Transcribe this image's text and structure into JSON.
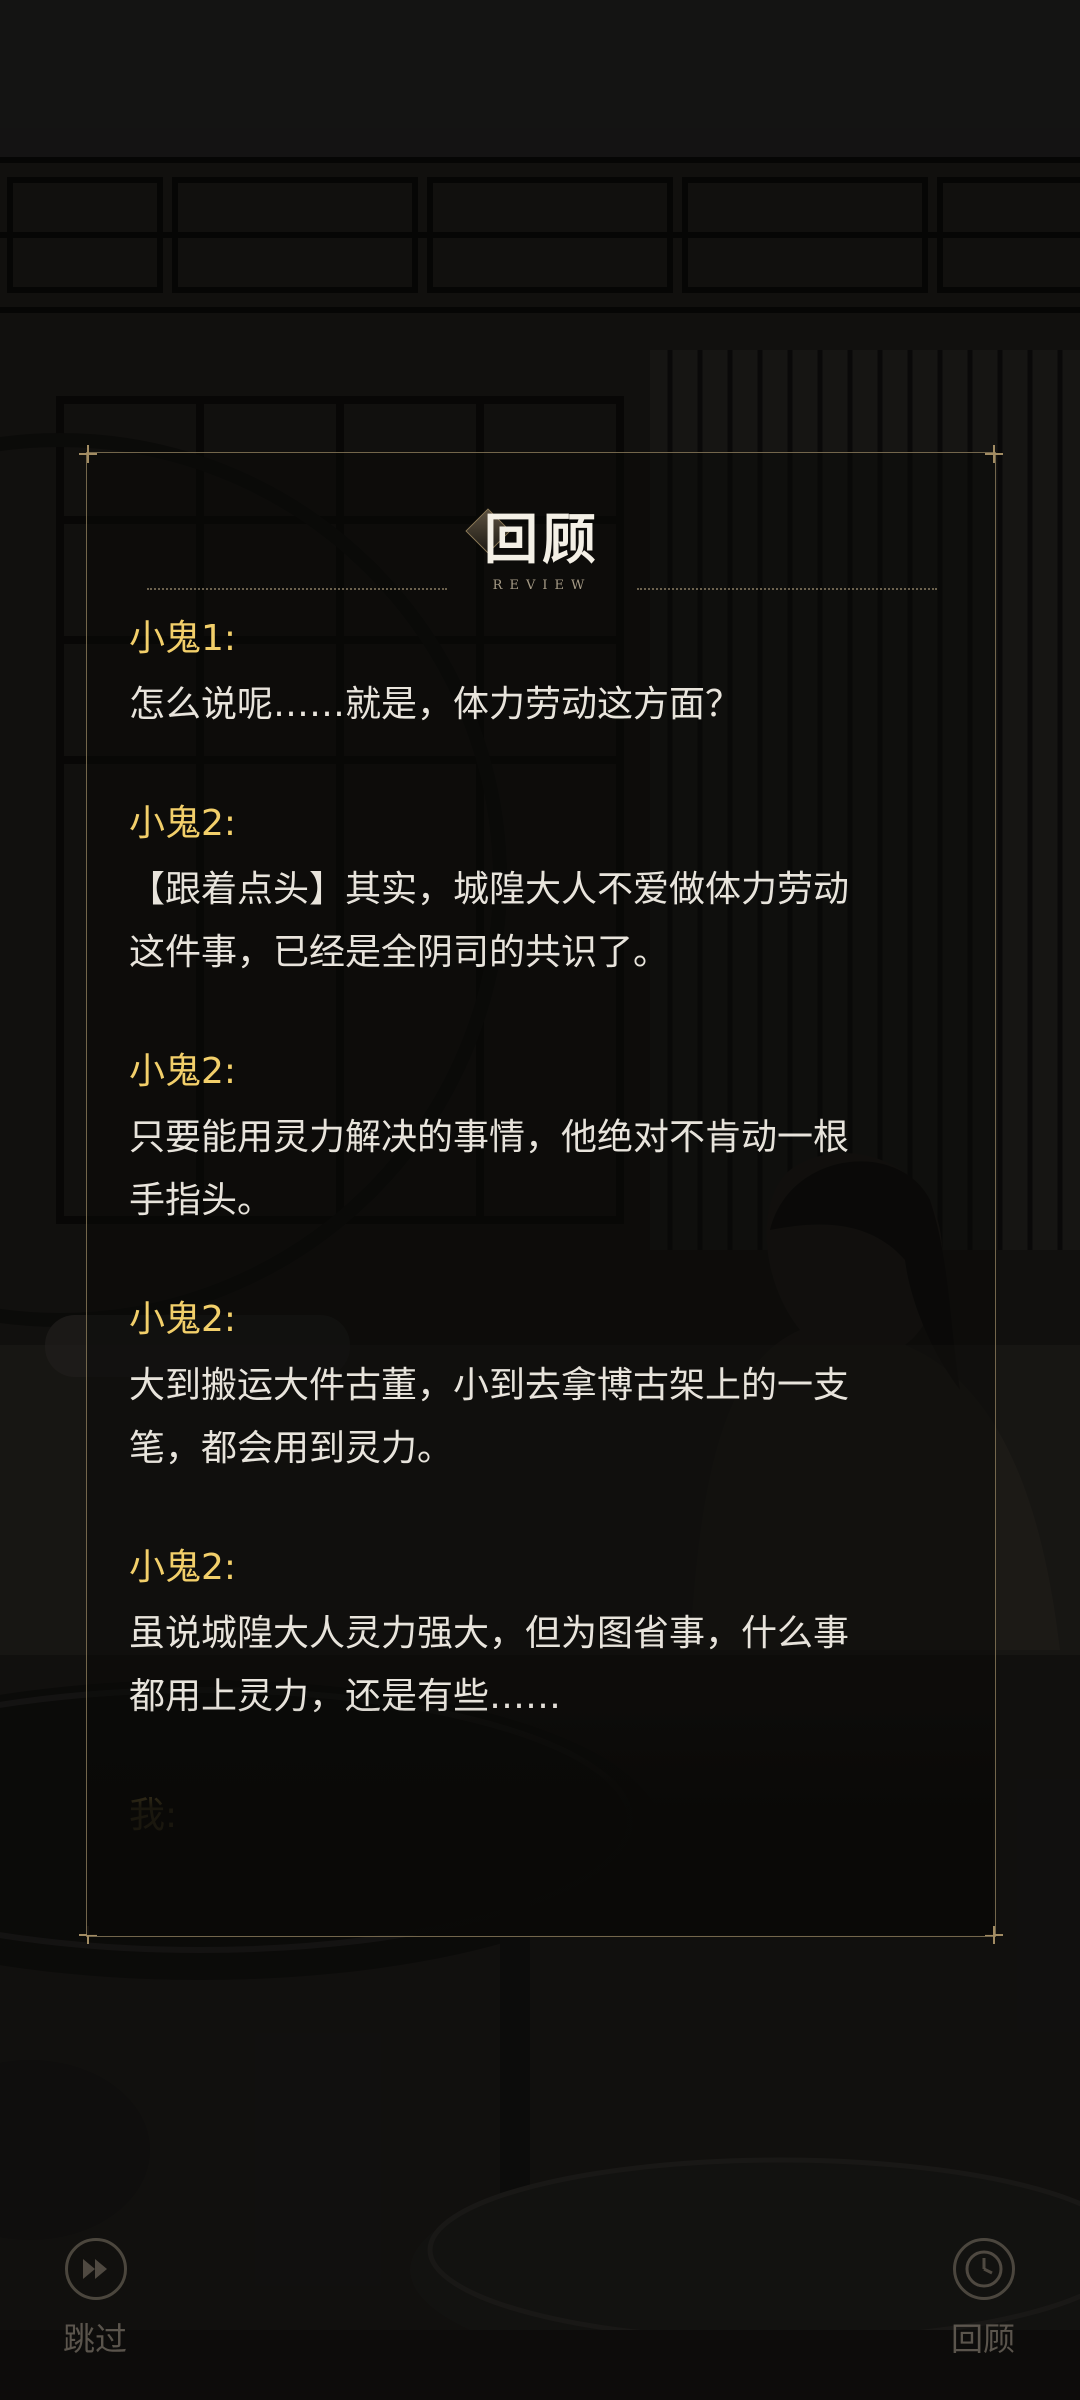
{
  "review": {
    "title": "回顾",
    "subtitle": "REVIEW"
  },
  "log": [
    {
      "speaker": "小鬼1:",
      "lines": [
        "怎么说呢……就是，体力劳动这方面？"
      ]
    },
    {
      "speaker": "小鬼2:",
      "lines": [
        "【跟着点头】其实，城隍大人不爱做体力劳动",
        "这件事，已经是全阴司的共识了。"
      ]
    },
    {
      "speaker": "小鬼2:",
      "lines": [
        "只要能用灵力解决的事情，他绝对不肯动一根",
        "手指头。"
      ]
    },
    {
      "speaker": "小鬼2:",
      "lines": [
        "大到搬运大件古董，小到去拿博古架上的一支",
        "笔，都会用到灵力。"
      ]
    },
    {
      "speaker": "小鬼2:",
      "lines": [
        "虽说城隍大人灵力强大，但为图省事，什么事",
        "都用上灵力，还是有些……"
      ]
    },
    {
      "speaker": "我:",
      "lines": []
    }
  ],
  "controls": {
    "skip_label": "跳过",
    "review_label": "回顾",
    "skip_icon": "fast-forward-icon",
    "review_icon": "clock-icon"
  },
  "colors": {
    "speaker": "#f2cf6a",
    "dialogue": "#e8e4dc",
    "frame": "#a28c63"
  }
}
